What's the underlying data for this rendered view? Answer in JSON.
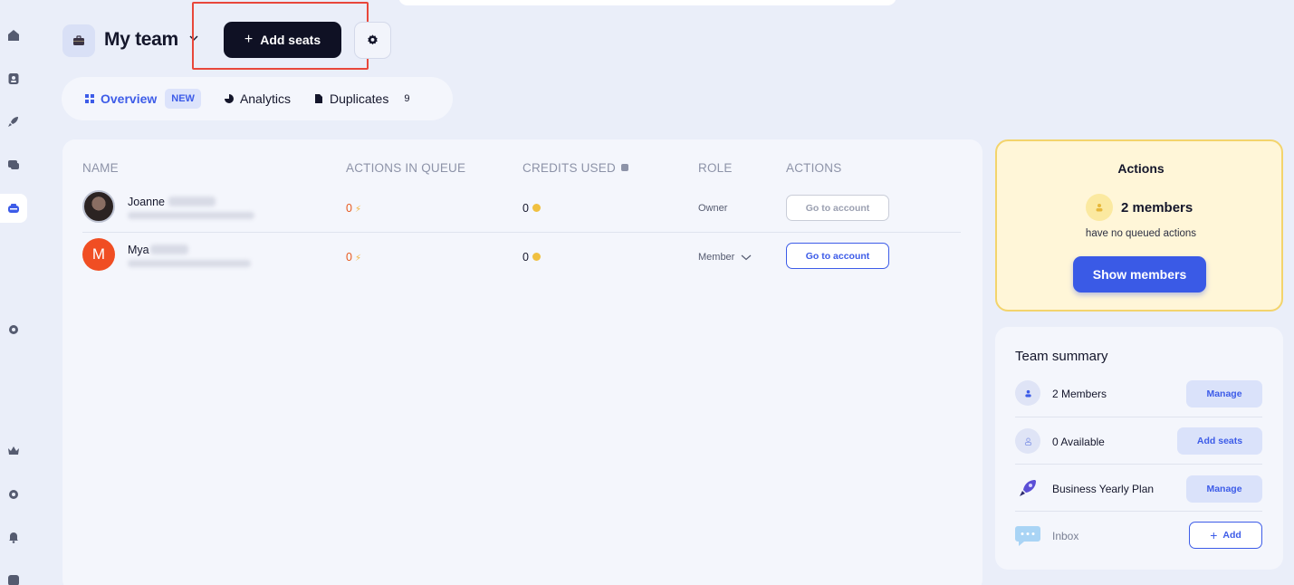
{
  "header": {
    "team_name": "My team",
    "add_seats_label": "Add seats"
  },
  "tabs": [
    {
      "label": "Overview",
      "badge": "NEW"
    },
    {
      "label": "Analytics"
    },
    {
      "label": "Duplicates",
      "count": "9"
    }
  ],
  "table": {
    "columns": [
      "NAME",
      "ACTIONS IN QUEUE",
      "CREDITS USED",
      "ROLE",
      "ACTIONS"
    ],
    "rows": [
      {
        "name": "Joanne",
        "avatar_letter": "",
        "queue": "0",
        "credits": "0",
        "role": "Owner",
        "action": "Go to account",
        "action_enabled": false
      },
      {
        "name": "Mya",
        "avatar_letter": "M",
        "queue": "0",
        "credits": "0",
        "role": "Member",
        "action": "Go to account",
        "action_enabled": true
      }
    ]
  },
  "actions_card": {
    "title": "Actions",
    "members_count": "2 members",
    "subtitle": "have no queued actions",
    "button": "Show members"
  },
  "summary": {
    "title": "Team summary",
    "rows": [
      {
        "label": "2 Members",
        "button": "Manage"
      },
      {
        "label": "0 Available",
        "button": "Add seats"
      },
      {
        "label": "Business Yearly Plan",
        "button": "Manage"
      },
      {
        "label": "Inbox",
        "button": "Add"
      }
    ]
  },
  "colors": {
    "accent": "#3d5ce8",
    "highlight": "#e8473b",
    "queue_number": "#e85a1f",
    "avatar_mya": "#f04e23"
  },
  "icons": [
    "home-icon",
    "contacts-icon",
    "rocket-icon",
    "chat-icon",
    "team-icon",
    "settings-icon",
    "crown-icon",
    "gear-icon",
    "bell-icon",
    "help-icon"
  ]
}
